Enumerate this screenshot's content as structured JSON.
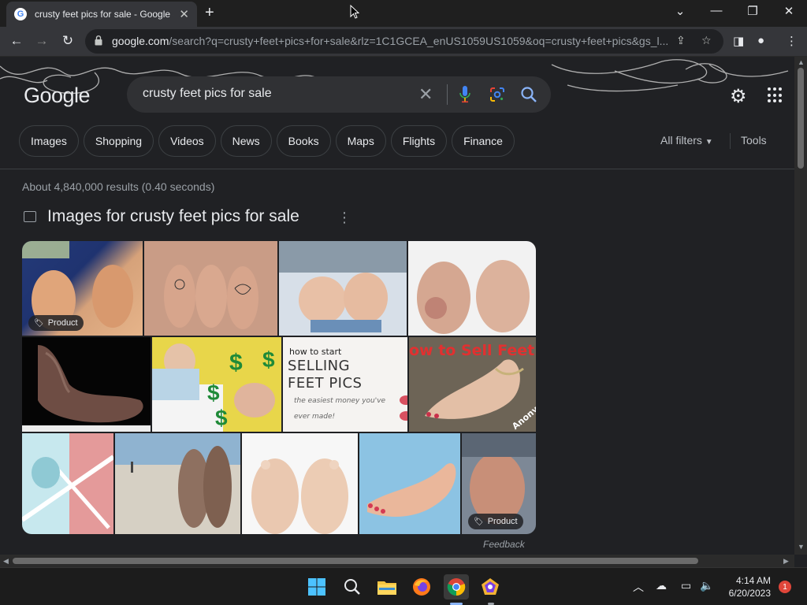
{
  "browser": {
    "tab_title": "crusty feet pics for sale - Google Search",
    "new_tab_glyph": "+",
    "url_host": "google.com",
    "url_rest": "/search?q=crusty+feet+pics+for+sale&rlz=1C1GCEA_enUS1059US1059&oq=crusty+feet+pics&gs_l..."
  },
  "search": {
    "logo": "Google",
    "query": "crusty feet pics for sale"
  },
  "chips": [
    "Images",
    "Shopping",
    "Videos",
    "News",
    "Books",
    "Maps",
    "Flights",
    "Finance"
  ],
  "filters": {
    "all_filters_label": "All filters",
    "tools_label": "Tools"
  },
  "results": {
    "stats": "About 4,840,000 results (0.40 seconds)",
    "images_heading": "Images for crusty feet pics for sale",
    "product_tag_label": "Product",
    "tile_texts": {
      "how_to_start": "how to start",
      "selling": "SELLING",
      "feet_pics": "FEET PICS",
      "tagline_1": "the easiest money you've",
      "tagline_2": "ever made!",
      "banner": "ow to Sell Feet P",
      "watermark": "Anony"
    },
    "feedback": "Feedback"
  },
  "taskbar": {
    "time": "4:14 AM",
    "date": "6/20/2023",
    "notification_count": "1"
  },
  "colors": {
    "page_bg": "#202124",
    "chip_border": "#3c4043",
    "search_box_bg": "#303134",
    "accent_blue": "#8ab4f8"
  }
}
